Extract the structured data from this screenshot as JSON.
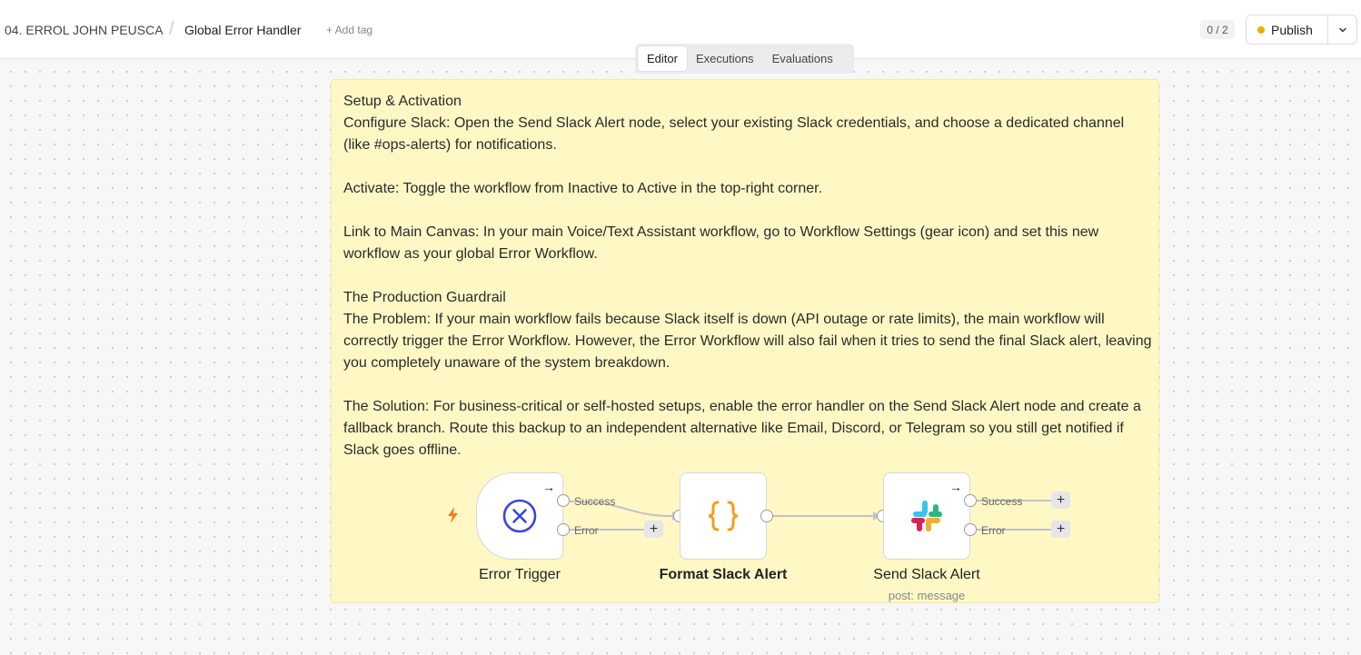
{
  "header": {
    "project": "04. ERROL JOHN PEUSCA",
    "separator": "/",
    "workflow_name": "Global Error Handler",
    "add_tag": "+ Add tag",
    "counter": "0 / 2",
    "publish_label": "Publish",
    "publish_status_color": "#e8b000"
  },
  "tabs": [
    {
      "label": "Editor",
      "active": true
    },
    {
      "label": "Executions",
      "active": false
    },
    {
      "label": "Evaluations",
      "active": false
    }
  ],
  "sticky_note": {
    "text": "Setup & Activation\nConfigure Slack: Open the Send Slack Alert node, select your existing Slack credentials, and choose a dedicated channel (like #ops-alerts) for notifications.\n\nActivate: Toggle the workflow from Inactive to Active in the top-right corner.\n\nLink to Main Canvas: In your main Voice/Text Assistant workflow, go to Workflow Settings (gear icon) and set this new workflow as your global Error Workflow.\n\nThe Production Guardrail\nThe Problem: If your main workflow fails because Slack itself is down (API outage or rate limits), the main workflow will correctly trigger the Error Workflow. However, the Error Workflow will also fail when it tries to send the final Slack alert, leaving you completely unaware of the system breakdown.\n\nThe Solution: For business-critical or self-hosted setups, enable the error handler on the Send Slack Alert node and create a fallback branch. Route this backup to an independent alternative like Email, Discord, or Telegram so you still get notified if Slack goes offline."
  },
  "nodes": {
    "error_trigger": {
      "label": "Error Trigger",
      "icon": "error-x-circle-icon",
      "success": "Success",
      "error": "Error"
    },
    "format": {
      "label": "Format Slack Alert",
      "icon": "braces-icon"
    },
    "slack": {
      "label": "Send Slack Alert",
      "sublabel": "post: message",
      "icon": "slack-icon",
      "success": "Success",
      "error": "Error"
    }
  },
  "colors": {
    "sticky_bg": "#fff8c5",
    "trigger_icon": "#3b46d6",
    "code_icon": "#f39c1f",
    "bolt": "#f57c1f"
  }
}
